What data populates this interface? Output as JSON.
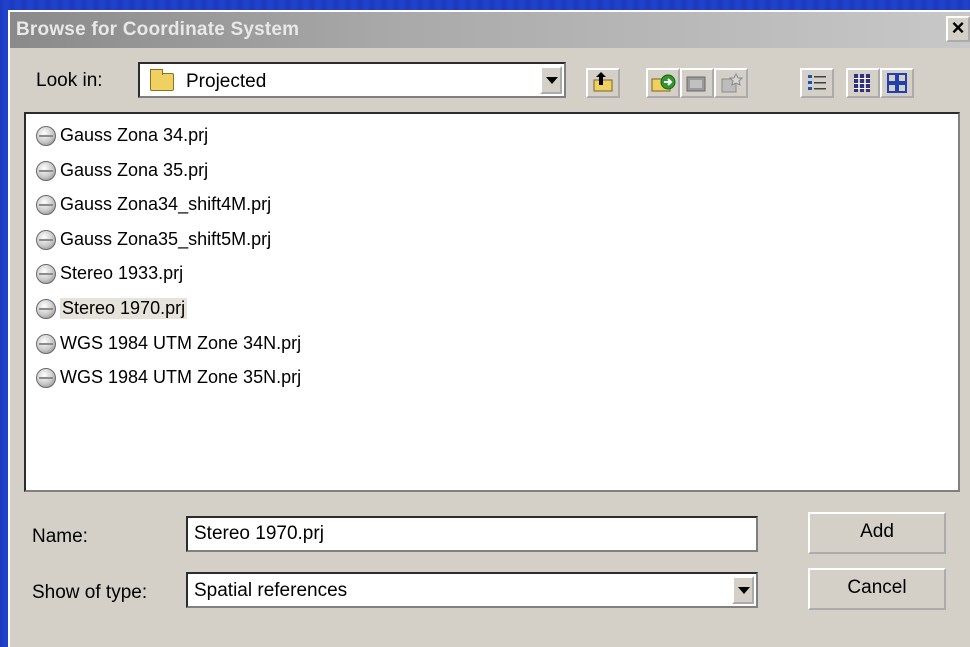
{
  "window": {
    "title": "Browse for Coordinate System",
    "close_glyph": "×"
  },
  "lookin": {
    "label": "Look in:",
    "value": "Projected",
    "folder_icon": "folder-icon"
  },
  "toolbar": {
    "buttons": [
      {
        "name": "up-one-level-button",
        "icon": "up-folder-icon"
      },
      {
        "name": "connect-to-folder-button",
        "icon": "connect-icon"
      },
      {
        "name": "disconnect-button",
        "icon": "disconnect-icon"
      },
      {
        "name": "new-coordinate-system-button",
        "icon": "new-icon"
      },
      {
        "name": "list-view-button",
        "icon": "list-view-icon"
      },
      {
        "name": "details-view-button",
        "icon": "details-view-icon"
      },
      {
        "name": "thumbnails-view-button",
        "icon": "thumbnails-icon"
      }
    ]
  },
  "files": [
    {
      "name": "Gauss Zona 34.prj",
      "selected": false
    },
    {
      "name": "Gauss Zona 35.prj",
      "selected": false
    },
    {
      "name": "Gauss Zona34_shift4M.prj",
      "selected": false
    },
    {
      "name": "Gauss Zona35_shift5M.prj",
      "selected": false
    },
    {
      "name": "Stereo 1933.prj",
      "selected": false
    },
    {
      "name": "Stereo 1970.prj",
      "selected": true
    },
    {
      "name": "WGS 1984 UTM Zone 34N.prj",
      "selected": false
    },
    {
      "name": "WGS 1984 UTM Zone 35N.prj",
      "selected": false
    }
  ],
  "form": {
    "name_label": "Name:",
    "name_value": "Stereo 1970.prj",
    "type_label": "Show of type:",
    "type_value": "Spatial references"
  },
  "buttons": {
    "add": "Add",
    "cancel": "Cancel"
  }
}
